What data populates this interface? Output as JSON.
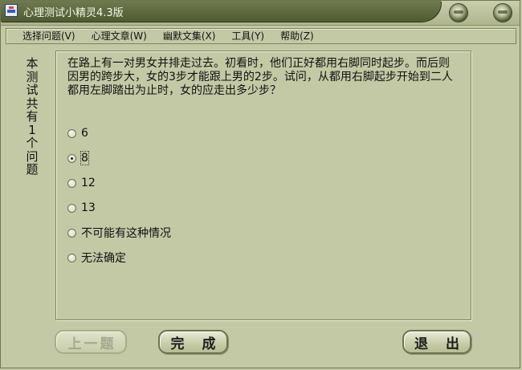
{
  "window": {
    "title": "心理测试小精灵4.3版"
  },
  "menu": [
    {
      "label": "选择问题(V)"
    },
    {
      "label": "心理文章(W)"
    },
    {
      "label": "幽默文集(X)"
    },
    {
      "label": "工具(Y)"
    },
    {
      "label": "帮助(Z)"
    }
  ],
  "sidebar": {
    "text": "本测试共有1个问题"
  },
  "question": {
    "text": "在路上有一对男女并排走过去。初看时，他们正好都用右脚同时起步。而后则因男的跨步大，女的3步才能跟上男的2步。试问，从都用右脚起步开始到二人都用左脚踏出为止时，女的应走出多少步？",
    "options": [
      {
        "label": "6",
        "checked": false
      },
      {
        "label": "8",
        "checked": true
      },
      {
        "label": "12",
        "checked": false
      },
      {
        "label": "13",
        "checked": false
      },
      {
        "label": "不可能有这种情况",
        "checked": false
      },
      {
        "label": "无法确定",
        "checked": false
      }
    ]
  },
  "buttons": {
    "prev": "上一题",
    "finish": "完 成",
    "exit": "退 出"
  },
  "colors": {
    "background": "#c3c9a5",
    "title_bar": "#5a6540",
    "title_text": "#f4f6e8"
  },
  "icons": {
    "app": "app-icon",
    "minimize": "minimize-icon",
    "close": "close-icon"
  }
}
